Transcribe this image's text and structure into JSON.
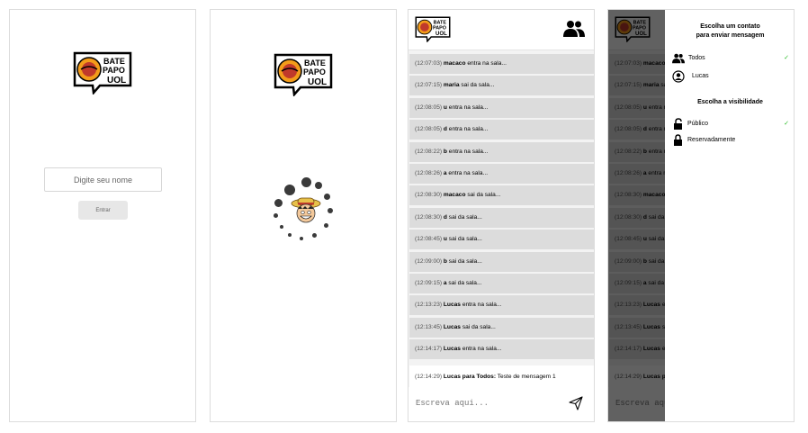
{
  "brand": {
    "logo_line1": "BATE",
    "logo_line2": "PAPO",
    "logo_line3": "UOL"
  },
  "login": {
    "name_placeholder": "Digite seu nome",
    "enter_label": "Entrar"
  },
  "chat": {
    "messages": [
      {
        "time": "(12:07:03)",
        "who": "macaco",
        "text": "entra na sala..."
      },
      {
        "time": "(12:07:15)",
        "who": "maria",
        "text": "sai da sala..."
      },
      {
        "time": "(12:08:05)",
        "who": "u",
        "text": "entra na sala..."
      },
      {
        "time": "(12:08:05)",
        "who": "d",
        "text": "entra na sala..."
      },
      {
        "time": "(12:08:22)",
        "who": "b",
        "text": "entra na sala..."
      },
      {
        "time": "(12:08:26)",
        "who": "a",
        "text": "entra na sala..."
      },
      {
        "time": "(12:08:30)",
        "who": "macaco",
        "text": "sai da sala..."
      },
      {
        "time": "(12:08:30)",
        "who": "d",
        "text": "sai da sala..."
      },
      {
        "time": "(12:08:45)",
        "who": "u",
        "text": "sai da sala..."
      },
      {
        "time": "(12:09:00)",
        "who": "b",
        "text": "sai da sala..."
      },
      {
        "time": "(12:09:15)",
        "who": "a",
        "text": "sai da sala..."
      },
      {
        "time": "(12:13:23)",
        "who": "Lucas",
        "text": "entra na sala..."
      },
      {
        "time": "(12:13:45)",
        "who": "Lucas",
        "text": "sai da sala..."
      },
      {
        "time": "(12:14:17)",
        "who": "Lucas",
        "text": "entra na sala..."
      },
      {
        "time": "(12:14:29)",
        "who": "Lucas para Todos:",
        "text": "Teste de mensagem 1"
      }
    ],
    "message_placeholder": "Escreva aqui..."
  },
  "sidebar": {
    "contacts_title_1": "Escolha um contato",
    "contacts_title_2": "para enviar mensagem",
    "contacts": [
      {
        "label": "Todos",
        "icon": "people-icon",
        "selected": true
      },
      {
        "label": "Lucas",
        "icon": "person-circle-icon",
        "selected": false
      }
    ],
    "visibility_title": "Escolha a visibilidade",
    "visibility": [
      {
        "label": "Público",
        "icon": "lock-open-icon",
        "selected": true
      },
      {
        "label": "Reservadamente",
        "icon": "lock-closed-icon",
        "selected": false
      }
    ],
    "check_mark": "✓"
  },
  "colors": {
    "logo_orange": "#f39c1a",
    "logo_red": "#c0392b",
    "check_green": "#28bb25",
    "message_bg": "#dcdcdc",
    "overlay": "rgba(0,0,0,0.62)"
  }
}
